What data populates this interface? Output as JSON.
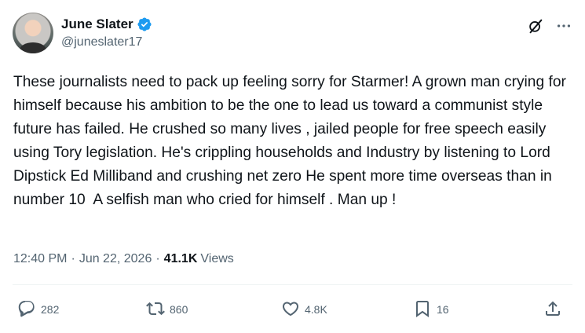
{
  "author": {
    "display_name": "June Slater",
    "handle": "@juneslater17",
    "verified_color": "#1d9bf0"
  },
  "header_icons": [
    "grok-icon",
    "more-icon"
  ],
  "tweet": {
    "text": "These journalists need to pack up feeling sorry for Starmer! A grown man crying for himself because his ambition to be the one to lead us toward a communist style future has failed. He crushed so many lives , jailed people for free speech easily using Tory legislation. He's crippling households and Industry by listening to Lord Dipstick Ed Milliband and crushing net zero He spent more time overseas than in number 10  A selfish man who cried for himself . Man up !"
  },
  "meta": {
    "time": "12:40 PM",
    "date": "Jun 22, 2026",
    "views_count": "41.1K",
    "views_label": "Views"
  },
  "actions": {
    "replies": "282",
    "reposts": "860",
    "likes": "4.8K",
    "bookmarks": "16"
  },
  "colors": {
    "text": "#0f1419",
    "secondary": "#536471",
    "divider": "#eff3f4"
  }
}
